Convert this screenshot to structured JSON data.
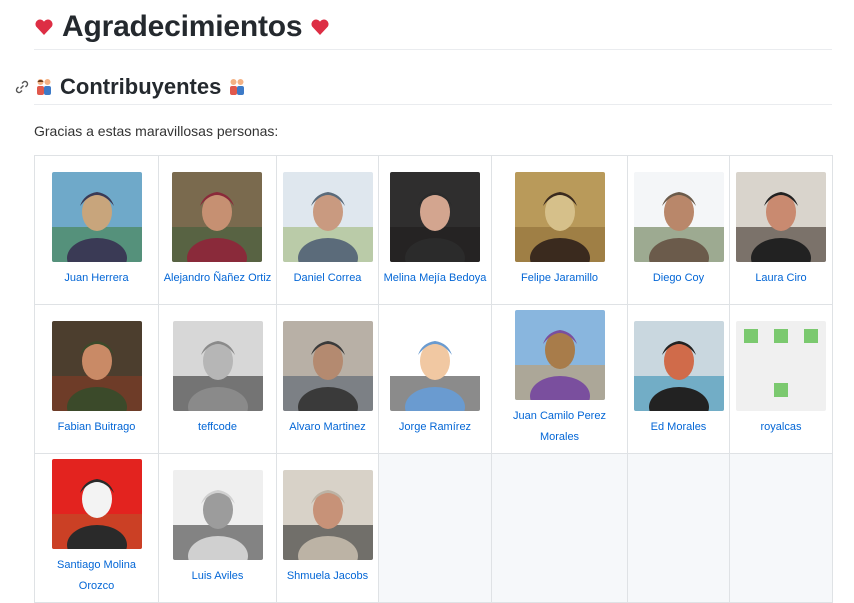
{
  "title": "Agradecimientos",
  "section": "Contribuyentes",
  "intro": "Gracias a estas maravillosas personas:",
  "colors": {
    "link": "#0366d6",
    "heart": "#dd2e44"
  },
  "icons": {
    "title": "heart-icon",
    "section": "people-icon",
    "anchor": "link-icon"
  },
  "contributors": [
    {
      "name": "Juan Herrera",
      "avatar": [
        "#6fa9c9",
        "#3f7d3a",
        "#c8a57c",
        "#3a3a55"
      ]
    },
    {
      "name": "Alejandro Ñañez Ortiz",
      "avatar": [
        "#7a6a4e",
        "#3d5c3a",
        "#c69072",
        "#8a2a3a"
      ]
    },
    {
      "name": "Daniel Correa",
      "avatar": [
        "#dfe7ee",
        "#9ab46f",
        "#c99a80",
        "#5b6b7a"
      ]
    },
    {
      "name": "Melina Mejía Bedoya",
      "avatar": [
        "#2f2e2e",
        "#1d1c1c",
        "#d3a58f",
        "#2b2b2b"
      ]
    },
    {
      "name": "Felipe Jaramillo",
      "avatar": [
        "#b99a5a",
        "#8a6a35",
        "#d6c08a",
        "#3a2a1e"
      ]
    },
    {
      "name": "Diego Coy",
      "avatar": [
        "#f4f6f8",
        "#556b3d",
        "#b9876a",
        "#6b5b4b"
      ]
    },
    {
      "name": "Laura Ciro",
      "avatar": [
        "#d9d4cc",
        "#2d2019",
        "#c98a70",
        "#222"
      ]
    },
    {
      "name": "Fabian Buitrago",
      "avatar": [
        "#4c3e2e",
        "#8a3a25",
        "#c98a66",
        "#3b4a2a"
      ]
    },
    {
      "name": "teffcode",
      "avatar": [
        "#d7d7d7",
        "#222",
        "#b6b6b6",
        "#8a8a8a"
      ]
    },
    {
      "name": "Alvaro Martinez",
      "avatar": [
        "#b8b0a6",
        "#4a5a6a",
        "#b48a70",
        "#3a3a3a"
      ]
    },
    {
      "name": "Jorge Ramírez",
      "avatar": [
        "#ffffff",
        "#2b2b2b",
        "#f1c8a2",
        "#6a9bd0"
      ]
    },
    {
      "name": "Juan Camilo Perez Morales",
      "avatar": [
        "#89b6de",
        "#c99a5e",
        "#a87c4a",
        "#7a4f9e"
      ]
    },
    {
      "name": "Ed Morales",
      "avatar": [
        "#c9d7df",
        "#2a8ab0",
        "#d06b4a",
        "#222"
      ]
    },
    {
      "name": "royalcas",
      "avatar": [
        "#f0f0f0",
        "#7bc96f",
        "#7bc96f",
        "#7bc96f"
      ]
    },
    {
      "name": "Santiago Molina Orozco",
      "avatar": [
        "#e3231f",
        "#b85a2a",
        "#f3f3f3",
        "#2a2a2a"
      ]
    },
    {
      "name": "Luis Aviles",
      "avatar": [
        "#efefef",
        "#2a2a2a",
        "#9c9c9c",
        "#d0d0d0"
      ]
    },
    {
      "name": "Shmuela Jacobs",
      "avatar": [
        "#d8d2c8",
        "#1e1e1e",
        "#c79278",
        "#bcb3a5"
      ]
    }
  ]
}
